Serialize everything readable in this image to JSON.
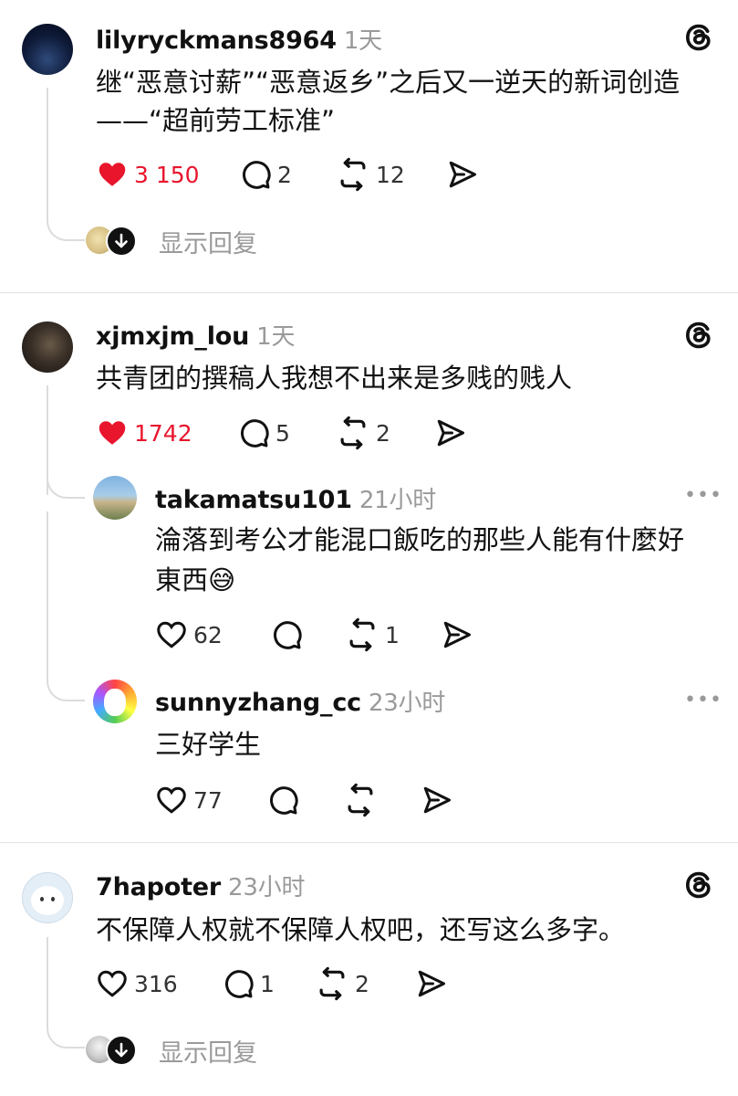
{
  "colors": {
    "like_red": "#e8152d",
    "muted": "#9a9a9a",
    "text": "#111111",
    "line": "#dcdcdc"
  },
  "posts": [
    {
      "username": "lilyryckmans8964",
      "time": "1天",
      "text_lines": [
        "继“恶意讨薪”“恶意返乡”之后又一逆天的新词创造",
        "——“超前劳工标准”"
      ],
      "likes": "3 150",
      "liked": true,
      "comments": "2",
      "reposts": "12",
      "show_replies": "显示回复",
      "icon": "threads-icon"
    },
    {
      "username": "xjmxjm_lou",
      "time": "1天",
      "text_lines": [
        "共青团的撰稿人我想不出来是多贱的贱人"
      ],
      "likes": "1742",
      "liked": true,
      "comments": "5",
      "reposts": "2",
      "icon": "threads-icon",
      "replies": [
        {
          "username": "takamatsu101",
          "time": "21小时",
          "text_lines": [
            "淪落到考公才能混口飯吃的那些人能有什麼好",
            "東西😅"
          ],
          "likes": "62",
          "comments": "",
          "reposts": "1",
          "more": "•••"
        },
        {
          "username": "sunnyzhang_cc",
          "time": "23小时",
          "text_lines": [
            "三好学生"
          ],
          "likes": "77",
          "comments": "",
          "reposts": "",
          "more": "•••"
        }
      ]
    },
    {
      "username": "7hapoter",
      "time": "23小时",
      "text_lines": [
        "不保障人权就不保障人权吧，还写这么多字。"
      ],
      "likes": "316",
      "liked": false,
      "comments": "1",
      "reposts": "2",
      "show_replies": "显示回复",
      "icon": "threads-icon"
    }
  ]
}
